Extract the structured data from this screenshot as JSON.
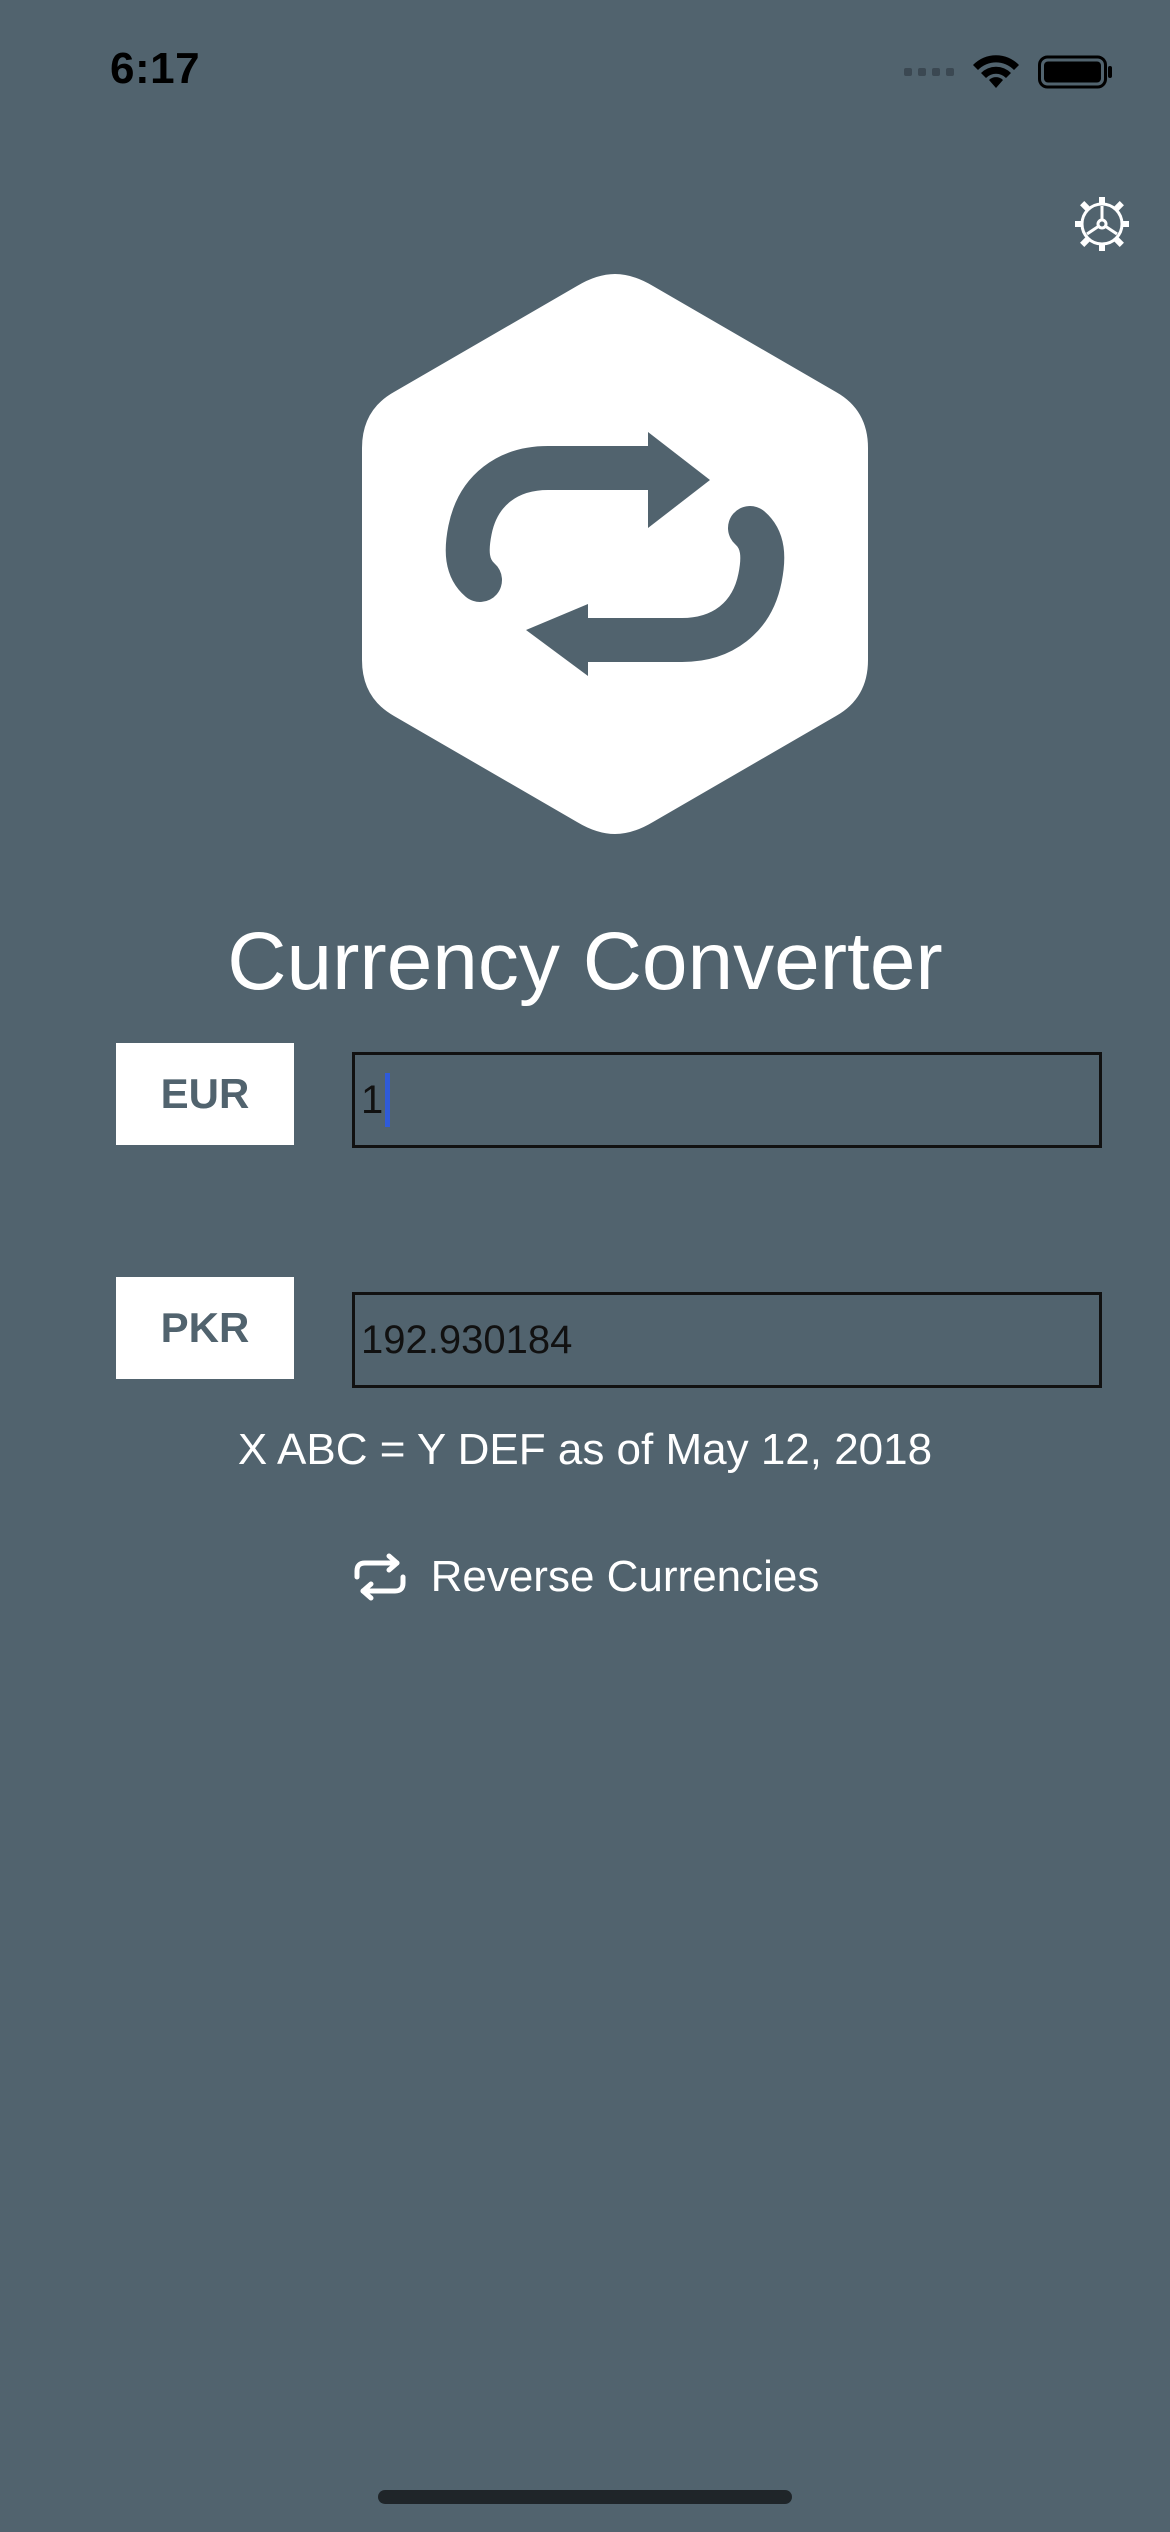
{
  "status_bar": {
    "time": "6:17",
    "icons": [
      "signal-icon",
      "wifi-icon",
      "battery-icon"
    ]
  },
  "settings": {
    "icon": "gear-icon"
  },
  "logo": {
    "icon": "exchange-arrows-icon"
  },
  "title": "Currency Converter",
  "base": {
    "currency": "EUR",
    "amount": "1"
  },
  "target": {
    "currency": "PKR",
    "amount": "192.930184"
  },
  "rate_text": "X ABC = Y DEF as of May 12, 2018",
  "reverse": {
    "label": "Reverse Currencies",
    "icon": "swap-icon"
  },
  "colors": {
    "background": "#51636E",
    "accent_white": "#FFFFFF",
    "caret": "#2F5BD9"
  }
}
